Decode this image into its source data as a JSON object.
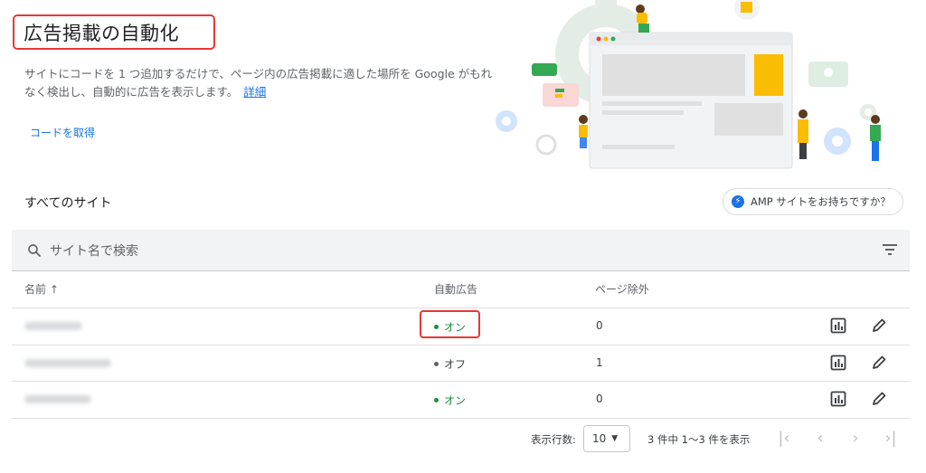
{
  "header": {
    "title": "広告掲載の自動化",
    "description": "サイトにコードを 1 つ追加するだけで、ページ内の広告掲載に適した場所を Google がもれなく検出し、自動的に広告を表示します。",
    "details_link": "詳細",
    "get_code_link": "コードを取得"
  },
  "sites": {
    "heading": "すべてのサイト",
    "amp_button": "AMP サイトをお持ちですか？",
    "search_placeholder": "サイト名で検索",
    "columns": {
      "name": "名前 ↑",
      "auto_ads": "自動広告",
      "page_exclusions": "ページ除外"
    },
    "rows": [
      {
        "auto_ads": "オン",
        "page_exclusions": "0"
      },
      {
        "auto_ads": "オフ",
        "page_exclusions": "1"
      },
      {
        "auto_ads": "オン",
        "page_exclusions": "0"
      }
    ]
  },
  "footer": {
    "rows_per_page_label": "表示行数:",
    "rows_per_page_value": "10",
    "range_text": "3 件中 1～3 件を表示"
  },
  "colors": {
    "accent": "#1a73e8",
    "status_on": "#1e8e3e",
    "highlight_box": "#e53935"
  }
}
